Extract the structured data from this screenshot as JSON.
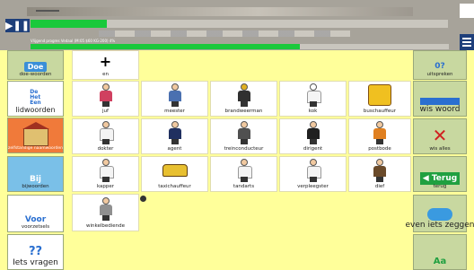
{
  "player": {
    "play_icon": "play-pause-icon",
    "info_text": "Vlijgend progres Vedaal (M:05 $60 KG-200) 4%",
    "progress_primary": 0.17,
    "progress_secondary": 0.64
  },
  "left": [
    {
      "label": "doe-woorden",
      "name": "doe-woorden"
    },
    {
      "label": "lidwoorden",
      "name": "lidwoorden"
    },
    {
      "label": "zelfstandige naamwoorden",
      "name": "zelfstandige-naamwoorden"
    },
    {
      "label": "bijwoorden",
      "name": "bijwoorden"
    },
    {
      "label": "voorzetsels",
      "name": "voorzetsels"
    },
    {
      "label": "Iets vragen",
      "name": "iets-vragen"
    }
  ],
  "left_icon_text": {
    "doe": "Doe",
    "de": "De",
    "het": "Het",
    "een": "Een",
    "bij": "Bij",
    "voor": "Voor",
    "q": "??"
  },
  "grid": {
    "en": "en",
    "row1": [
      "juf",
      "meester",
      "brandweerman",
      "kok",
      "buschauffeur"
    ],
    "row2": [
      "dokter",
      "agent",
      "treinconducteur",
      "dirigent",
      "postbode"
    ],
    "row3": [
      "kapper",
      "taxichauffeur",
      "tandarts",
      "verpleegster",
      "dief"
    ],
    "row4": [
      "winkelbediende"
    ]
  },
  "right": [
    {
      "label": "uitspreken",
      "name": "uitspreken"
    },
    {
      "label": "wis woord",
      "name": "wis-woord"
    },
    {
      "label": "wis alles",
      "name": "wis-alles"
    },
    {
      "label": "terug",
      "name": "terug"
    },
    {
      "label": "even iets zeggen",
      "name": "even-iets-zeggen"
    },
    {
      "label": "",
      "name": "abc"
    }
  ],
  "right_icon_text": {
    "terug": "Terug",
    "uitspreken": "0?",
    "abc": "Aa"
  },
  "colors": {
    "bg": "#ffff9a",
    "green": "#19c93b",
    "navy": "#1e3f7a",
    "side": "#c8d8a0"
  }
}
